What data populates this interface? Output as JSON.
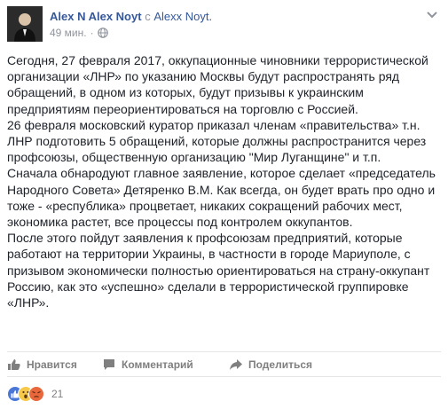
{
  "post": {
    "author": "Alex N Alex Noyt",
    "with_word": "с",
    "tagged": "Alexx Noyt.",
    "time": "49 мин.",
    "separator": "·",
    "audience_icon": "globe-icon",
    "options_icon": "chevron-down-icon",
    "paragraphs": [
      "Сегодня, 27 февраля 2017, оккупационные чиновники террористической организации «ЛНР» по указанию Москвы будут распространять ряд обращений, в одном из которых, будут призывы к украинским предприятиям переориентироваться на торговлю с Россией.",
      "26 февраля московский куратор приказал членам «правительства» т.н. ЛНР подготовить 5 обращений, которые должны распространится через профсоюзы, общественную организацию \"Мир Луганщине\" и т.п.",
      "Сначала обнародуют главное заявление, которое сделает «председатель Народного Совета» Детяренко В.М. Как всегда, он будет врать про одно и тоже - «республика» процветает, никаких сокращений рабочих мест, экономика растет, все процессы под контролем оккупантов.",
      "После этого пойдут заявления к профсоюзам предприятий, которые работают на территории Украины, в частности в городе Мариуполе, с призывом экономически полностью ориентироваться на страну-оккупант Россию, как это «успешно» сделали в террористической группировке «ЛНР»."
    ]
  },
  "actions": {
    "like_label": "Нравится",
    "comment_label": "Комментарий",
    "share_label": "Поделиться"
  },
  "reactions": {
    "icons": [
      "like",
      "wow",
      "angry"
    ],
    "count": "21",
    "colors": {
      "like": "#4a76d8",
      "wow": "#f7c94a",
      "angry": "#e8683b"
    }
  },
  "colors": {
    "link": "#365899",
    "text": "#1d2129",
    "muted": "#90949c"
  }
}
